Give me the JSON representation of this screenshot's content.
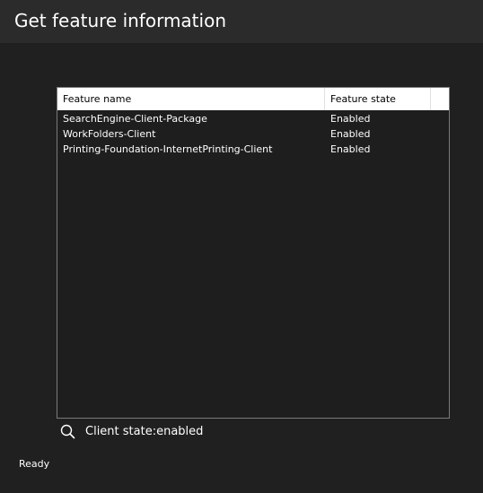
{
  "window": {
    "title": "Get feature information"
  },
  "table": {
    "columns": [
      "Feature name",
      "Feature state"
    ],
    "rows": [
      {
        "name": "SearchEngine-Client-Package",
        "state": "Enabled"
      },
      {
        "name": "WorkFolders-Client",
        "state": "Enabled"
      },
      {
        "name": "Printing-Foundation-InternetPrinting-Client",
        "state": "Enabled"
      }
    ]
  },
  "search": {
    "icon": "search-icon",
    "value": "Client state:enabled"
  },
  "status": {
    "text": "Ready"
  },
  "colors": {
    "background": "#202020",
    "title_bar": "#2b2b2b",
    "header_bg": "#ffffff",
    "text": "#ffffff"
  }
}
